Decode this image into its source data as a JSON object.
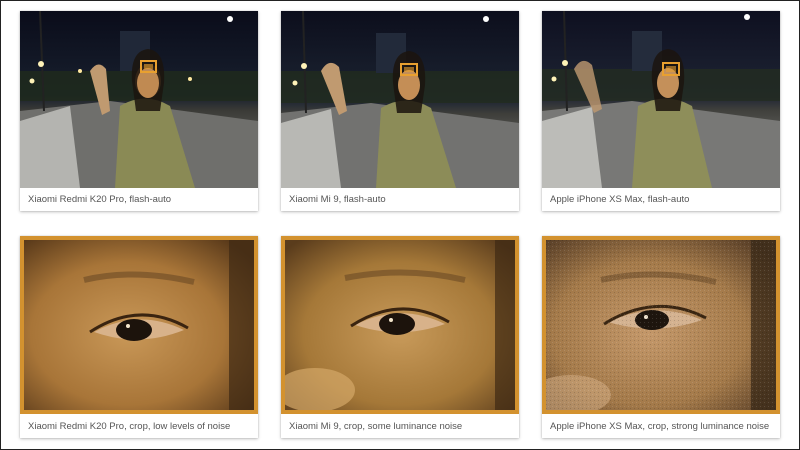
{
  "photos": [
    {
      "caption": "Xiaomi Redmi K20 Pro, flash-auto",
      "icon": "night-portrait-photo"
    },
    {
      "caption": "Xiaomi Mi 9, flash-auto",
      "icon": "night-portrait-photo"
    },
    {
      "caption": "Apple iPhone XS Max, flash-auto",
      "icon": "night-portrait-photo"
    },
    {
      "caption": "Xiaomi Redmi K20 Pro, crop, low levels of noise",
      "icon": "eye-crop-photo"
    },
    {
      "caption": "Xiaomi Mi 9, crop, some luminance noise",
      "icon": "eye-crop-photo"
    },
    {
      "caption": "Apple iPhone XS Max, crop, strong luminance noise",
      "icon": "eye-crop-photo"
    }
  ],
  "colors": {
    "crop_border": "#d3922f",
    "highlight_box": "#e8a030",
    "caption_text": "#555555"
  }
}
